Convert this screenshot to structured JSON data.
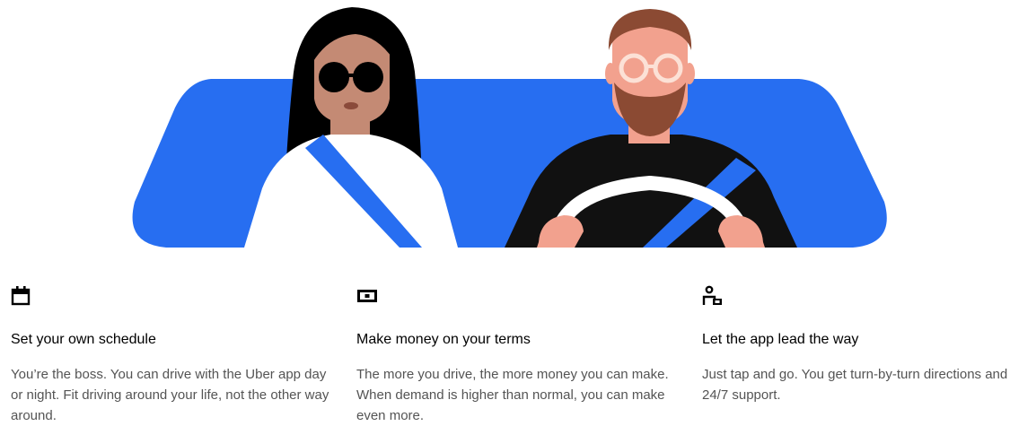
{
  "features": [
    {
      "icon": "calendar-icon",
      "title": "Set your own schedule",
      "body": "You’re the boss. You can drive with the Uber app day or night. Fit driving around your life, not the other way around."
    },
    {
      "icon": "cash-icon",
      "title": "Make money on your terms",
      "body": "The more you drive, the more money you can make. When demand is higher than normal, you can make even more."
    },
    {
      "icon": "person-pin-icon",
      "title": "Let the app lead the way",
      "body": "Just tap and go. You get turn-by-turn directions and 24/7 support."
    }
  ],
  "colors": {
    "windshield": "#276EF1",
    "skin_left": "#C48A74",
    "skin_right": "#F2A18E",
    "beard": "#8B4A33",
    "hair_right": "#8B4A33",
    "shirt_left": "#FFFFFF",
    "shirt_right": "#111111",
    "text_secondary": "#545454"
  }
}
